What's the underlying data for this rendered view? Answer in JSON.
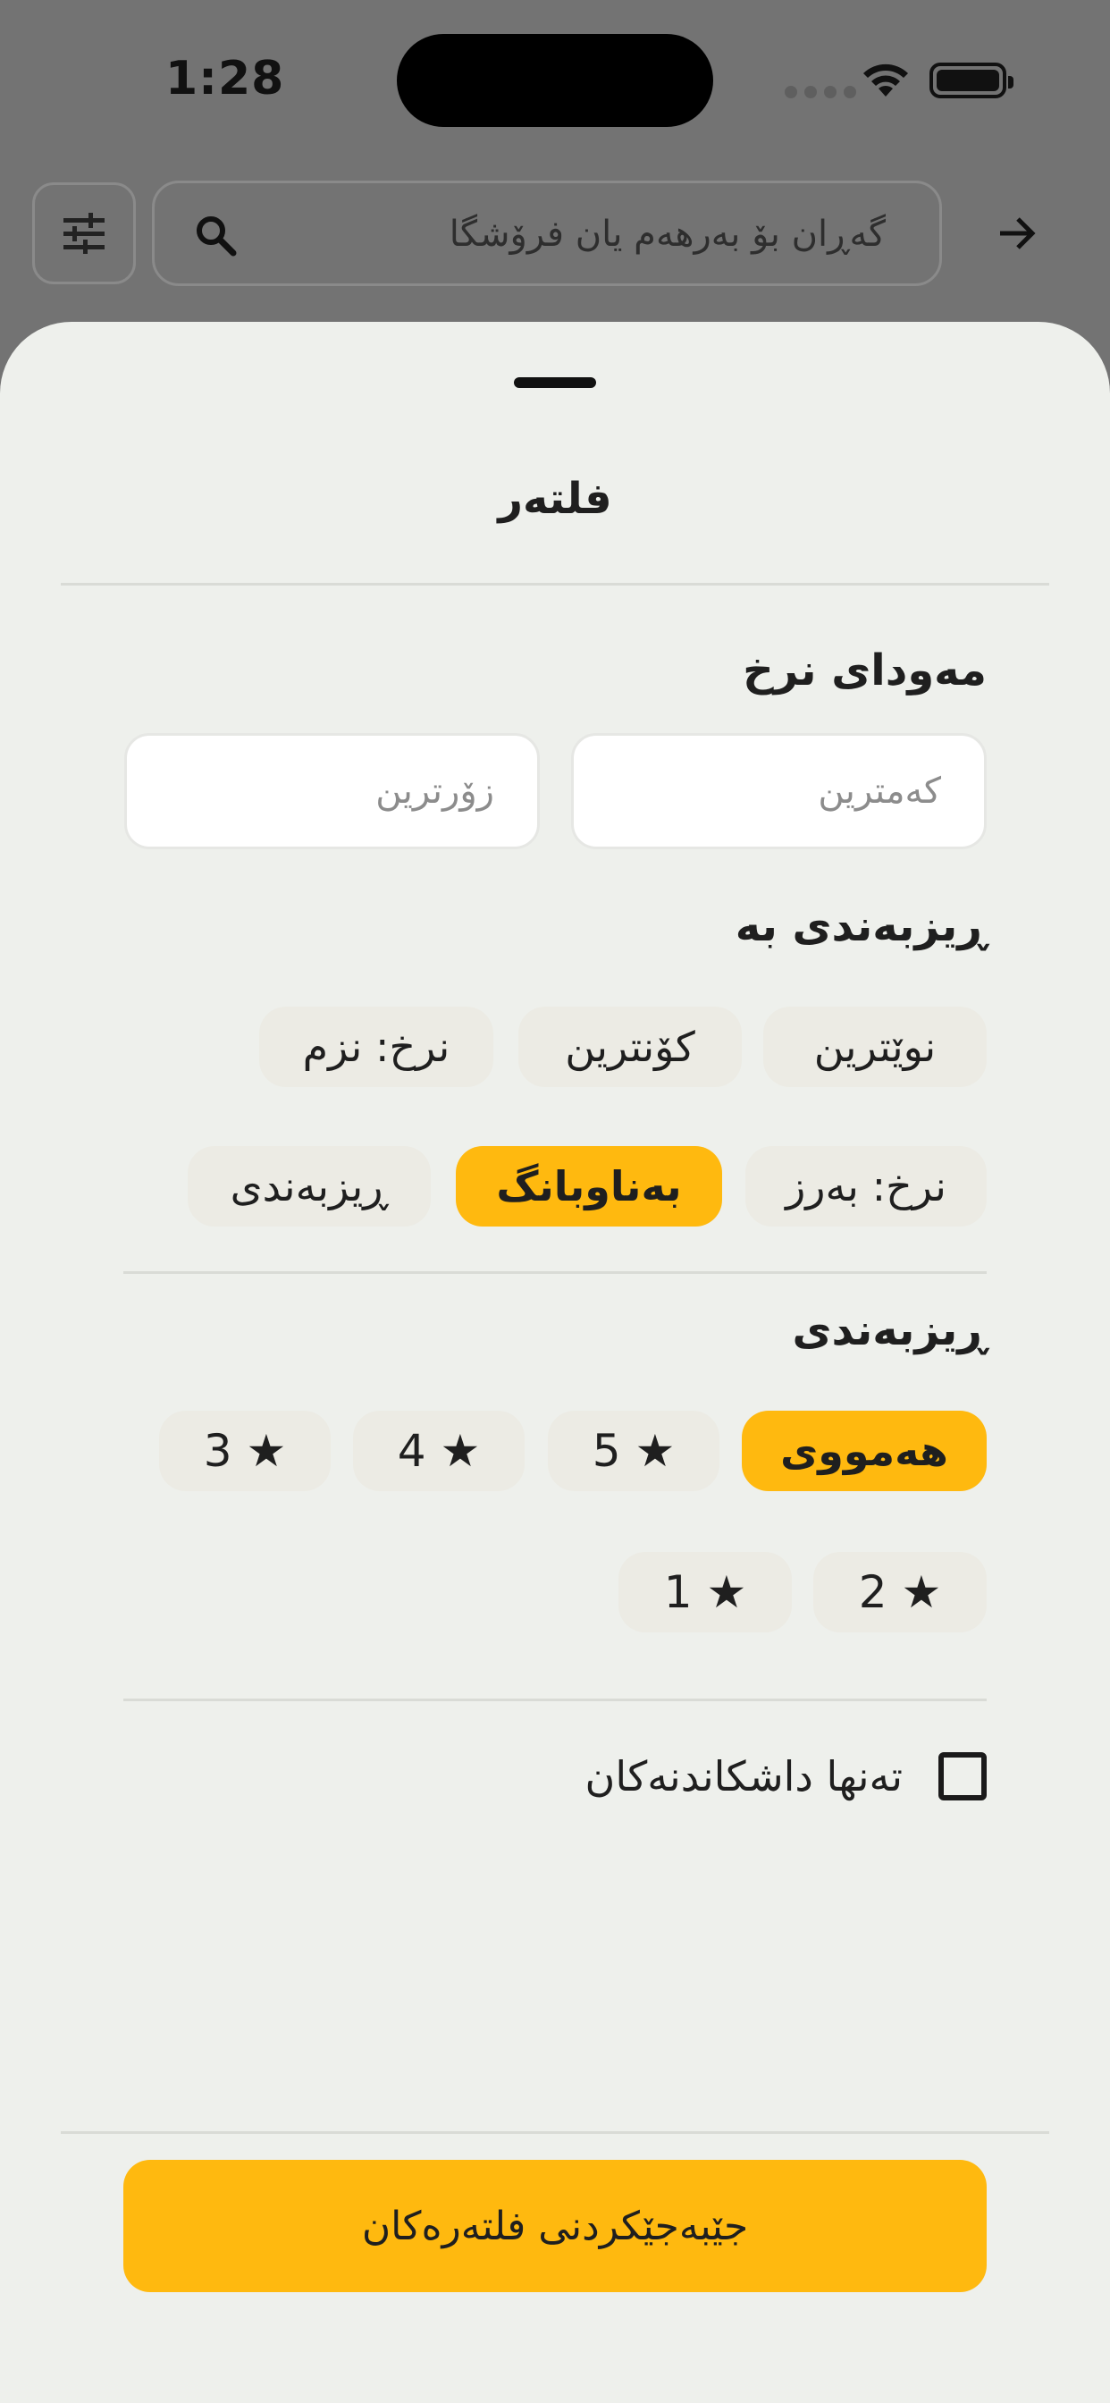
{
  "status_bar": {
    "time": "1:28"
  },
  "search": {
    "placeholder": "گەڕان بۆ بەرهەم یان فرۆشگا"
  },
  "icons": {
    "filter": "tune-sliders-icon",
    "search": "search-icon",
    "forward": "arrow-right-icon",
    "wifi": "wifi-icon",
    "battery": "battery-icon",
    "rating_star": "star-icon"
  },
  "sheet": {
    "title": "فلتەر",
    "price_range": {
      "heading": "مەودای نرخ",
      "min_placeholder": "کەمترین",
      "max_placeholder": "زۆرترین"
    },
    "sort_by": {
      "heading": "ڕیزبەندی بە",
      "options": [
        "نوێترین",
        "کۆنترین",
        "نرخ: نزم",
        "نرخ: بەرز",
        "بەناوبانگ",
        "ڕیزبەندی"
      ],
      "selected": "بەناوبانگ"
    },
    "rating": {
      "heading": "ڕیزبەندی",
      "all_label": "هەمووی",
      "options": [
        "5 ★",
        "4 ★",
        "3 ★",
        "2 ★",
        "1 ★"
      ],
      "selected": "هەمووی"
    },
    "discount_only": {
      "label": "تەنها داشکاندنەکان",
      "checked": false
    },
    "apply_label": "جێبەجێکردنی فلتەرەکان"
  },
  "colors": {
    "accent": "#FFB90F",
    "sheet_bg": "#EEF0EC",
    "chip_bg": "#ECEBE4",
    "overlay": "#737373"
  }
}
